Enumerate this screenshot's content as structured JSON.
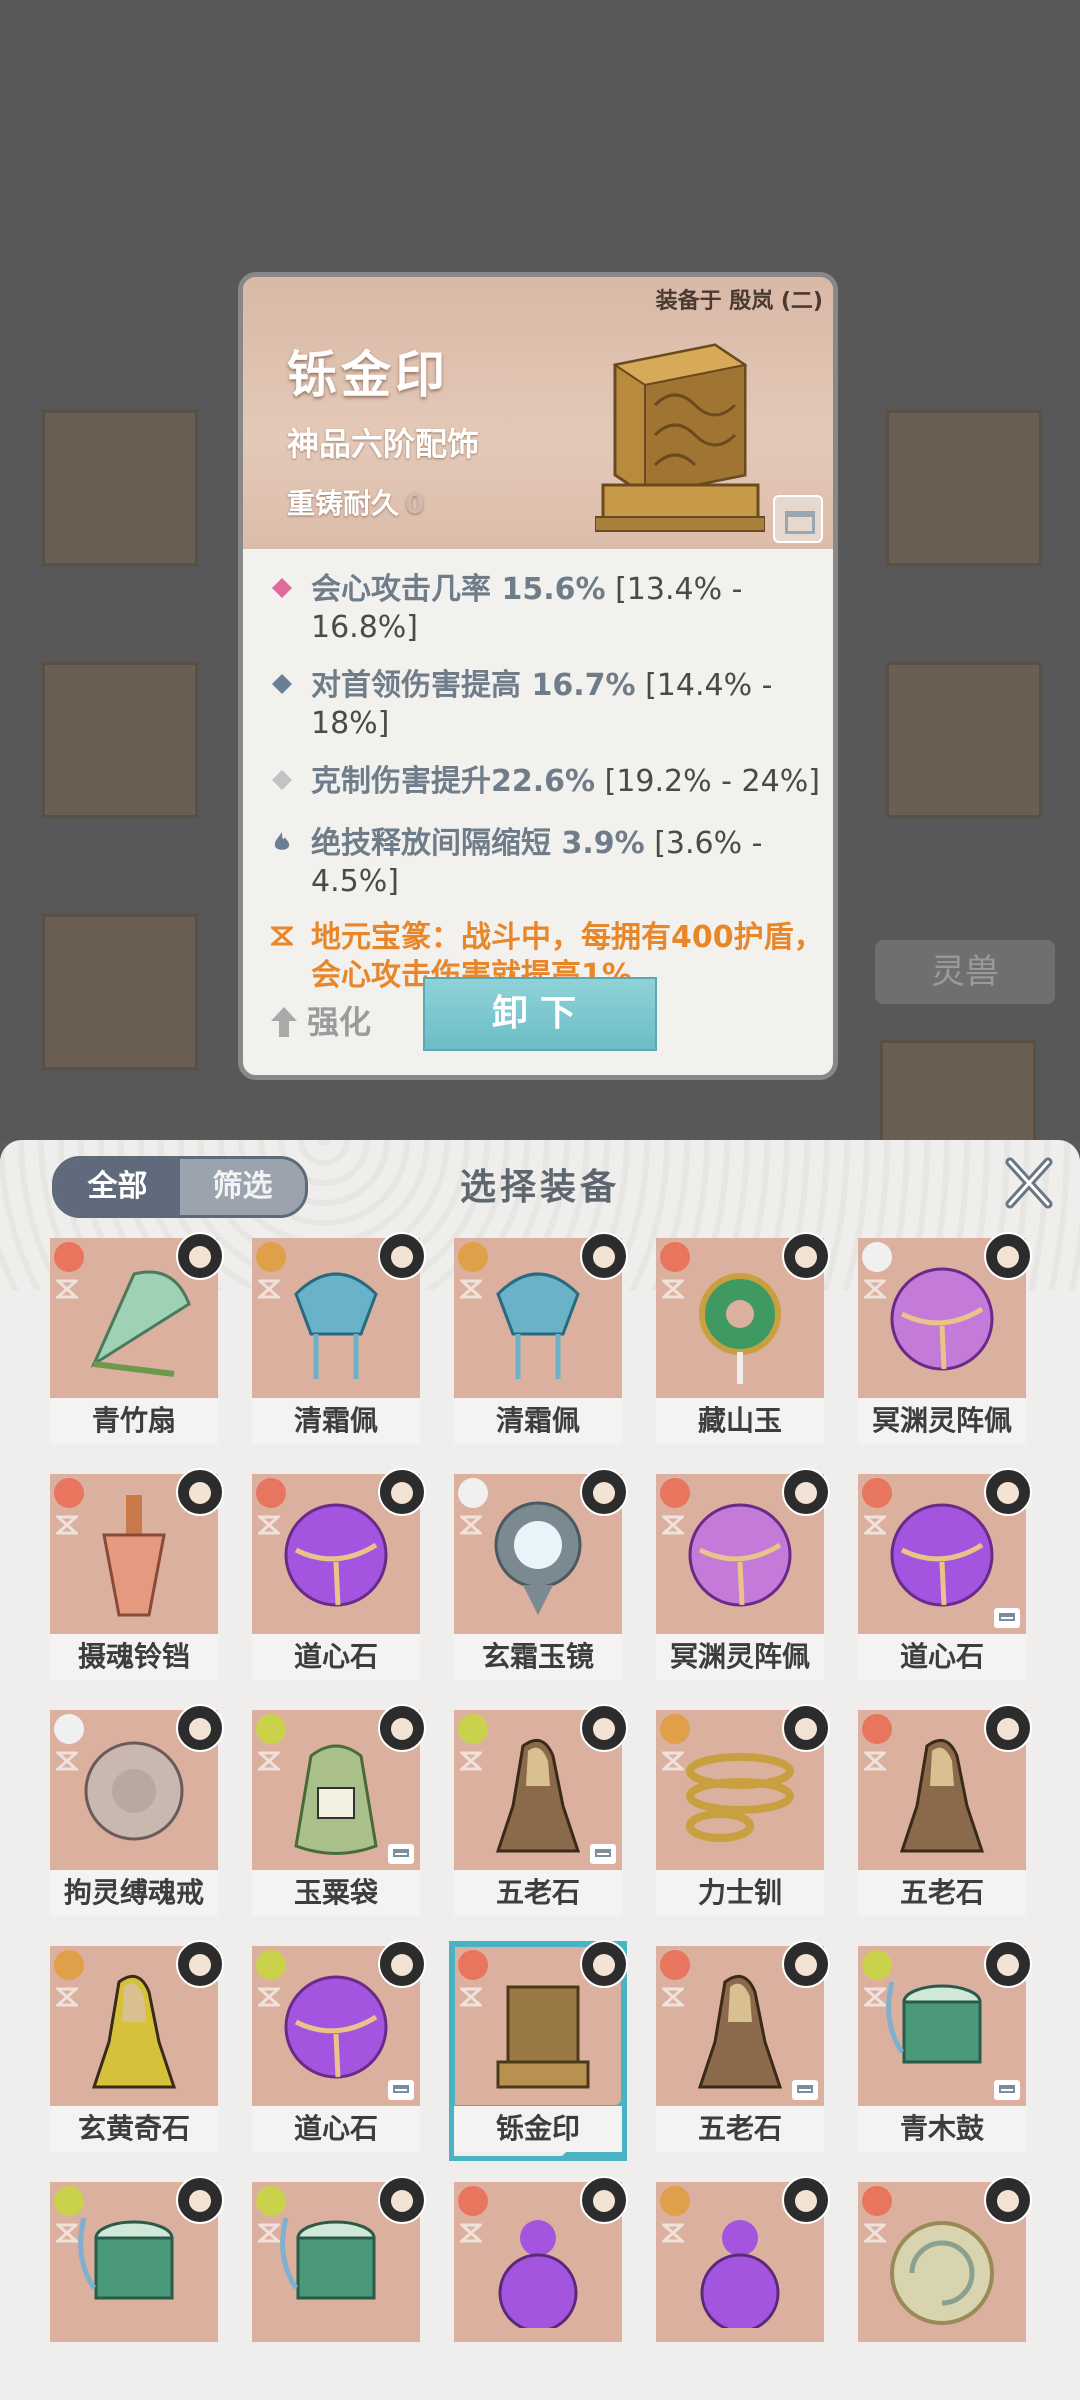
{
  "detail": {
    "equipped_by": "装备于 殷岚 (二)",
    "name": "铄金印",
    "type": "神品六阶配饰",
    "durability_label": "重铸耐久",
    "durability_value": "0",
    "stats": [
      {
        "label": "会心攻击几率 ",
        "value": "15.6%",
        "range": " [13.4% - 16.8%]",
        "icon": "pink-diamond-icon",
        "color": "#e06b9a"
      },
      {
        "label": "对首领伤害提高 ",
        "value": "16.7%",
        "range": " [14.4% - 18%]",
        "icon": "blue-diamond-icon",
        "color": "#6a7f95"
      },
      {
        "label": "克制伤害提升",
        "value": "22.6%",
        "range": " [19.2% - 24%]",
        "icon": "grey-diamond-icon",
        "color": "#c3c3c3"
      },
      {
        "label": "绝技释放间隔缩短 ",
        "value": "3.9%",
        "range": " [3.6% - 4.5%]",
        "icon": "flame-icon",
        "color": "#6a7f95"
      }
    ],
    "special": "地元宝篆：战斗中，每拥有400护盾，会心攻击伤害就提高1%",
    "strengthen_label": "强化",
    "unequip_label": "卸下"
  },
  "background": {
    "spirit_tab": "灵兽"
  },
  "panel": {
    "filter_all": "全部",
    "filter_screen": "筛选",
    "title": "选择装备",
    "items": [
      {
        "name": "青竹扇",
        "elem": "#e8765f",
        "art": "#9fd2b4",
        "shape": "fan",
        "tag": false
      },
      {
        "name": "清霜佩",
        "elem": "#e0a04a",
        "art": "#6ab2c8",
        "shape": "pendant",
        "tag": false
      },
      {
        "name": "清霜佩",
        "elem": "#e0a04a",
        "art": "#6ab2c8",
        "shape": "pendant",
        "tag": false
      },
      {
        "name": "藏山玉",
        "elem": "#e8765f",
        "art": "#3f9a62",
        "shape": "jade",
        "tag": false
      },
      {
        "name": "冥渊灵阵佩",
        "elem": "#f0f0f0",
        "art": "#c47ad8",
        "shape": "orb",
        "tag": false
      },
      {
        "name": "摄魂铃铛",
        "elem": "#e8765f",
        "art": "#e59a80",
        "shape": "bell",
        "tag": false
      },
      {
        "name": "道心石",
        "elem": "#e8765f",
        "art": "#a455e0",
        "shape": "orb",
        "tag": false
      },
      {
        "name": "玄霜玉镜",
        "elem": "#f0f0f0",
        "art": "#a0c8d8",
        "shape": "mirror",
        "tag": false
      },
      {
        "name": "冥渊灵阵佩",
        "elem": "#e8765f",
        "art": "#c47ad8",
        "shape": "orb",
        "tag": false
      },
      {
        "name": "道心石",
        "elem": "#e8765f",
        "art": "#a455e0",
        "shape": "orb",
        "tag": true
      },
      {
        "name": "拘灵缚魂戒",
        "elem": "#f0f0f0",
        "art": "#c9b8b0",
        "shape": "ring",
        "tag": false
      },
      {
        "name": "玉粟袋",
        "elem": "#c9d24a",
        "art": "#a9c08a",
        "shape": "bag",
        "tag": true
      },
      {
        "name": "五老石",
        "elem": "#c9d24a",
        "art": "#8a6a4a",
        "shape": "rock",
        "tag": true
      },
      {
        "name": "力士钏",
        "elem": "#e0a04a",
        "art": "#c9a040",
        "shape": "coil",
        "tag": false
      },
      {
        "name": "五老石",
        "elem": "#e8765f",
        "art": "#8a6a4a",
        "shape": "rock",
        "tag": false
      },
      {
        "name": "玄黄奇石",
        "elem": "#e0a04a",
        "art": "#d6c23a",
        "shape": "rock",
        "tag": false
      },
      {
        "name": "道心石",
        "elem": "#c9d24a",
        "art": "#a455e0",
        "shape": "orb",
        "tag": true
      },
      {
        "name": "铄金印",
        "elem": "#e8765f",
        "art": "#9a7a44",
        "shape": "seal",
        "tag": false,
        "selected": true
      },
      {
        "name": "五老石",
        "elem": "#e8765f",
        "art": "#8a6a4a",
        "shape": "rock",
        "tag": true
      },
      {
        "name": "青木鼓",
        "elem": "#c9d24a",
        "art": "#4a9a7a",
        "shape": "drum",
        "tag": true
      },
      {
        "name": "",
        "elem": "#c9d24a",
        "art": "#4a9a7a",
        "shape": "drum",
        "tag": false
      },
      {
        "name": "",
        "elem": "#c9d24a",
        "art": "#4a9a7a",
        "shape": "drum",
        "tag": false
      },
      {
        "name": "",
        "elem": "#e8765f",
        "art": "#a455e0",
        "shape": "gourd",
        "tag": false
      },
      {
        "name": "",
        "elem": "#e0a04a",
        "art": "#a455e0",
        "shape": "gourd",
        "tag": false
      },
      {
        "name": "",
        "elem": "#e8765f",
        "art": "#d8d4b0",
        "shape": "disc",
        "tag": false
      }
    ]
  }
}
